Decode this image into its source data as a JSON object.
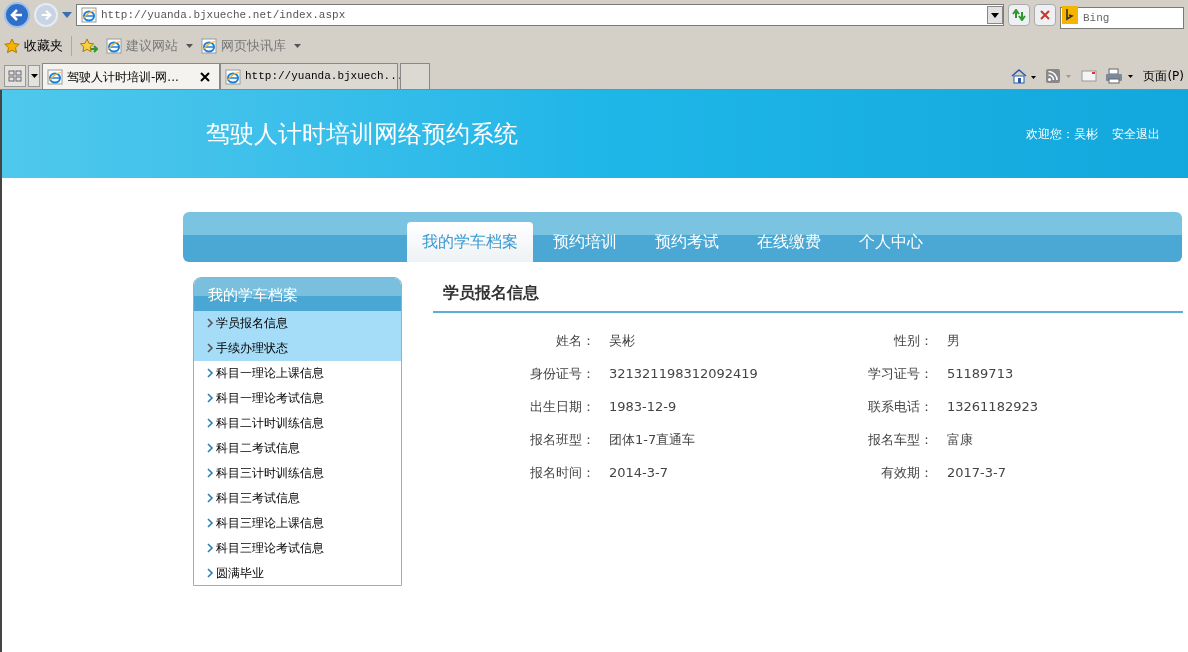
{
  "browser": {
    "address": "http://yuanda.bjxueche.net/index.aspx",
    "search_placeholder": "Bing",
    "favorites": [
      {
        "kind": "star",
        "label": "收藏夹"
      },
      {
        "kind": "link",
        "label": "建议网站"
      },
      {
        "kind": "link",
        "label": "网页快讯库"
      }
    ],
    "tabs": [
      {
        "label": "驾驶人计时培训-网...",
        "selected": true
      },
      {
        "label": "http://yuanda.bjxuech...",
        "selected": false
      }
    ],
    "page_menu": "页面(P)"
  },
  "header": {
    "title": "驾驶人计时培训网络预约系统",
    "welcome": "欢迎您：吴彬",
    "logout": "安全退出"
  },
  "nav": [
    {
      "label": "我的学车档案",
      "selected": true
    },
    {
      "label": "预约培训",
      "selected": false
    },
    {
      "label": "预约考试",
      "selected": false
    },
    {
      "label": "在线缴费",
      "selected": false
    },
    {
      "label": "个人中心",
      "selected": false
    }
  ],
  "sidebar": {
    "title": "我的学车档案",
    "items": [
      {
        "label": "学员报名信息",
        "selected": true
      },
      {
        "label": "手续办理状态",
        "selected": true
      },
      {
        "label": "科目一理论上课信息",
        "selected": false
      },
      {
        "label": "科目一理论考试信息",
        "selected": false
      },
      {
        "label": "科目二计时训练信息",
        "selected": false
      },
      {
        "label": "科目二考试信息",
        "selected": false
      },
      {
        "label": "科目三计时训练信息",
        "selected": false
      },
      {
        "label": "科目三考试信息",
        "selected": false
      },
      {
        "label": "科目三理论上课信息",
        "selected": false
      },
      {
        "label": "科目三理论考试信息",
        "selected": false
      },
      {
        "label": "圆满毕业",
        "selected": false
      }
    ]
  },
  "content": {
    "title": "学员报名信息",
    "fields": [
      {
        "label": "姓名：",
        "value": "吴彬"
      },
      {
        "label": "性别：",
        "value": "男"
      },
      {
        "label": "身份证号：",
        "value": "321321198312092419"
      },
      {
        "label": "学习证号：",
        "value": "51189713"
      },
      {
        "label": "出生日期：",
        "value": "1983-12-9"
      },
      {
        "label": "联系电话：",
        "value": "13261182923"
      },
      {
        "label": "报名班型：",
        "value": "团体1-7直通车"
      },
      {
        "label": "报名车型：",
        "value": "富康"
      },
      {
        "label": "报名时间：",
        "value": "2014-3-7"
      },
      {
        "label": "有效期：",
        "value": "2017-3-7"
      }
    ]
  }
}
